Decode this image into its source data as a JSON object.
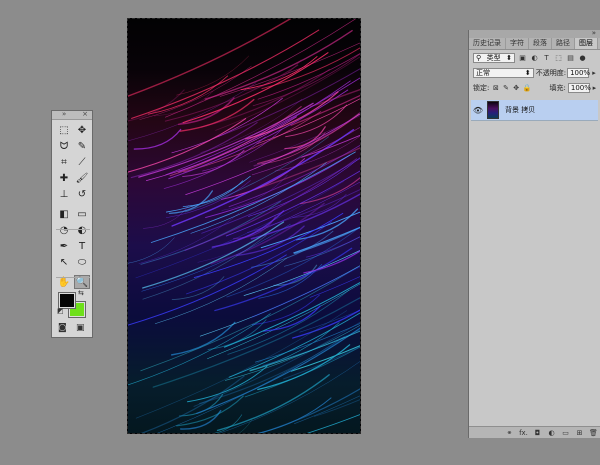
{
  "colors": {
    "workspace": "#8c8c8c",
    "foreground_swatch": "#050505",
    "background_swatch": "#6ee01a",
    "selected_layer": "#b9cff0"
  },
  "tools_panel": {
    "items": [
      {
        "name": "marquee-tool-icon",
        "glyph": "⬚"
      },
      {
        "name": "move-tool-icon",
        "glyph": "✥"
      },
      {
        "name": "lasso-tool-icon",
        "glyph": "ᗢ"
      },
      {
        "name": "quick-select-tool-icon",
        "glyph": "✎"
      },
      {
        "name": "crop-tool-icon",
        "glyph": "⌗"
      },
      {
        "name": "eyedropper-tool-icon",
        "glyph": "⟋"
      },
      {
        "name": "healing-brush-tool-icon",
        "glyph": "✚"
      },
      {
        "name": "brush-tool-icon",
        "glyph": "🖌"
      },
      {
        "name": "clone-stamp-tool-icon",
        "glyph": "⊥"
      },
      {
        "name": "history-brush-tool-icon",
        "glyph": "↺"
      },
      {
        "name": "eraser-tool-icon",
        "glyph": "◧"
      },
      {
        "name": "gradient-tool-icon",
        "glyph": "▭"
      },
      {
        "name": "blur-tool-icon",
        "glyph": "◔"
      },
      {
        "name": "dodge-tool-icon",
        "glyph": "◐"
      },
      {
        "name": "pen-tool-icon",
        "glyph": "✒"
      },
      {
        "name": "type-tool-icon",
        "glyph": "T"
      },
      {
        "name": "path-select-tool-icon",
        "glyph": "↖"
      },
      {
        "name": "ellipse-tool-icon",
        "glyph": "⬭"
      },
      {
        "name": "hand-tool-icon",
        "glyph": "✋"
      },
      {
        "name": "zoom-tool-icon",
        "glyph": "🔍"
      }
    ]
  },
  "layers_panel": {
    "tabs": [
      "历史记录",
      "字符",
      "段落",
      "路径",
      "图层"
    ],
    "filter_label": "类型",
    "blend_mode": "正常",
    "opacity_label": "不透明度:",
    "opacity_value": "100%",
    "lock_label": "锁定:",
    "fill_label": "填充:",
    "fill_value": "100%",
    "layer_name": "背景 拷贝",
    "bottom_fx": "fx."
  }
}
